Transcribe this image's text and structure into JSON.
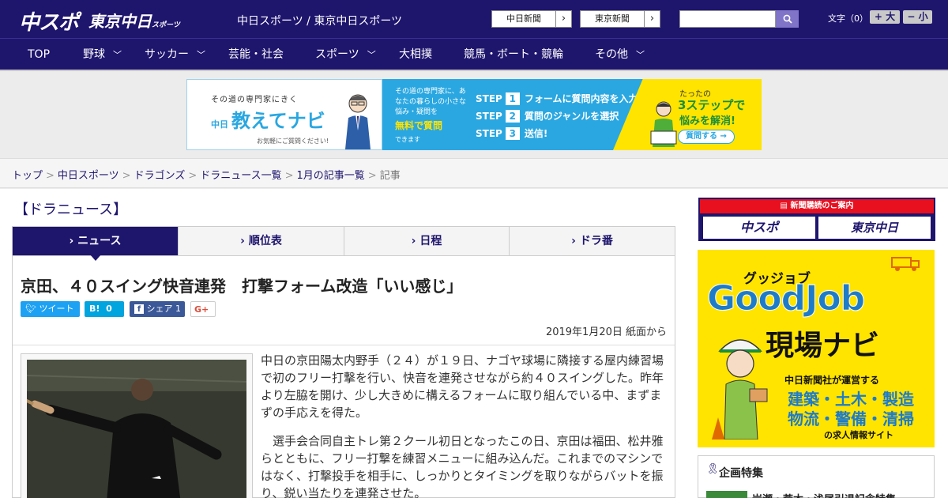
{
  "header": {
    "logo_primary": "中スポ",
    "logo_secondary": "東京中日",
    "logo_secondary_small": "スポーツ",
    "site_links": "中日スポーツ / 東京中日スポーツ",
    "ext_links": [
      {
        "label": "中日新聞"
      },
      {
        "label": "東京新聞"
      }
    ],
    "search": {
      "placeholder": "",
      "value": ""
    },
    "font_size_label": "文字（0）",
    "font_larger": "+ 大",
    "font_smaller": "− 小"
  },
  "nav": {
    "items": [
      {
        "label": "TOP",
        "has_menu": false
      },
      {
        "label": "野球",
        "has_menu": true
      },
      {
        "label": "サッカー",
        "has_menu": true
      },
      {
        "label": "芸能・社会",
        "has_menu": false
      },
      {
        "label": "スポーツ",
        "has_menu": true
      },
      {
        "label": "大相撲",
        "has_menu": false
      },
      {
        "label": "競馬・ボート・競輪",
        "has_menu": false
      },
      {
        "label": "その他",
        "has_menu": true
      }
    ]
  },
  "banner": {
    "tagline": "その道の専門家にきく",
    "brand_prefix": "中日",
    "brand": "教えてナビ",
    "sub": "お気軽にご質問ください!",
    "desc": "その道の専門家に、あなたの暮らしの小さな悩み・疑問を",
    "free": "無料で質問",
    "can": "できます",
    "steps": [
      {
        "n": "1",
        "text": "フォームに質問内容を入力"
      },
      {
        "n": "2",
        "text": "質問のジャンルを選択"
      },
      {
        "n": "3",
        "text": "送信!"
      }
    ],
    "step_word": "STEP",
    "right_1": "たったの",
    "right_2": "3ステップで",
    "right_3": "悩みを解消!",
    "cta": "質問する →"
  },
  "breadcrumb": {
    "items": [
      "トップ",
      "中日スポーツ",
      "ドラゴンズ",
      "ドラニュース一覧",
      "1月の記事一覧"
    ],
    "current": "記事"
  },
  "section_title": "【ドラニュース】",
  "tabs": [
    {
      "label": "ニュース",
      "active": true
    },
    {
      "label": "順位表",
      "active": false
    },
    {
      "label": "日程",
      "active": false
    },
    {
      "label": "ドラ番",
      "active": false
    }
  ],
  "article": {
    "headline": "京田、４０スイング快音連発　打撃フォーム改造「いい感じ」",
    "share": {
      "tweet": "ツイート",
      "hatena_count": "0",
      "facebook": "シェア",
      "facebook_count": "1",
      "gplus": "G+"
    },
    "date": "2019年1月20日 紙面から",
    "paragraphs": [
      "中日の京田陽太内野手（２４）が１９日、ナゴヤ球場に隣接する屋内練習場で初のフリー打撃を行い、快音を連発させながら約４０スイングした。昨年より左脇を開け、少し大きめに構えるフォームに取り組んでいる中、まずまずの手応えを得た。",
      "　選手会合同自主トレ第２クール初日となったこの日、京田は福田、松井雅らとともに、フリー打撃を練習メニューに組み込んだ。これまでのマシンではなく、打撃投手を相手に、しっかりとタイミングを取りながらバットを振り、鋭い当たりを連発させた。"
    ]
  },
  "sidebar": {
    "subscribe_label": "新聞購読のご案内",
    "subscribe_left": "中スポ",
    "subscribe_right": "東京中日",
    "ad_kana": "グッジョブ",
    "ad_good": "GoodJob",
    "ad_nav": "現場ナビ",
    "ad_note": "中日新聞社が運営する",
    "ad_list1": "建築・土木・製造",
    "ad_list2": "物流・警備・清掃",
    "ad_end": "の求人情報サイト",
    "feature_title": "企画特集",
    "feature_item": "岩瀬・荒木・浅尾引退記念特集"
  },
  "colors": {
    "brand_navy": "#1e156d",
    "accent_blue": "#2aa7e1",
    "ad_yellow": "#ffe400",
    "red": "#e8101f"
  }
}
